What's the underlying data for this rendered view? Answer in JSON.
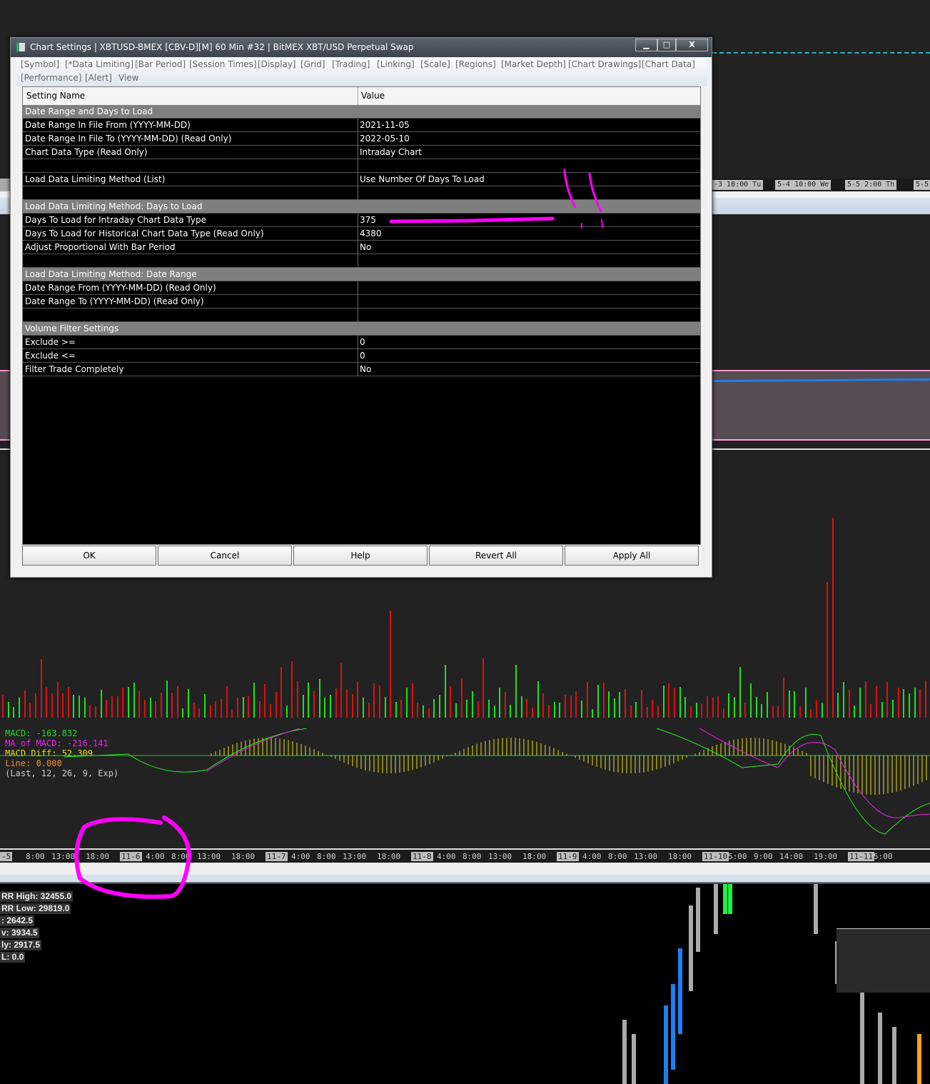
{
  "dialog": {
    "title": "Chart Settings | XBTUSD-BMEX [CBV-D][M]  60 Min   #32 | BitMEX XBT/USD Perpetual Swap",
    "minimize": "▁",
    "maximize": "□",
    "close": "X",
    "tabs": [
      "[Symbol]",
      "[*Data Limiting]",
      "[Bar Period]",
      "[Session Times]",
      "[Display]",
      "[Grid]",
      "[Trading]",
      "[Linking]",
      "[Scale]",
      "[Regions]",
      "[Market Depth]",
      "[Chart Drawings]",
      "[Chart Data]",
      "[Performance]",
      "[Alert]",
      "View"
    ],
    "columns": {
      "name": "Setting Name",
      "value": "Value"
    },
    "rows": [
      {
        "type": "sec",
        "name": "Date Range and Days to Load",
        "value": ""
      },
      {
        "type": "row",
        "name": "Date Range In File From (YYYY-MM-DD)",
        "value": "2021-11-05"
      },
      {
        "type": "row",
        "name": "Date Range In File To (YYYY-MM-DD) (Read Only)",
        "value": "2022-05-10"
      },
      {
        "type": "row",
        "name": "Chart Data Type (Read Only)",
        "value": "Intraday Chart"
      },
      {
        "type": "blank",
        "name": "",
        "value": ""
      },
      {
        "type": "row",
        "name": "Load Data Limiting Method (List)",
        "value": "Use Number Of Days To Load"
      },
      {
        "type": "blank",
        "name": "",
        "value": ""
      },
      {
        "type": "sec",
        "name": "Load Data Limiting Method: Days to Load",
        "value": ""
      },
      {
        "type": "row",
        "name": "Days To Load for Intraday Chart Data Type",
        "value": "375"
      },
      {
        "type": "row",
        "name": "Days To Load for Historical Chart Data Type (Read Only)",
        "value": "4380"
      },
      {
        "type": "row",
        "name": "Adjust Proportional With Bar Period",
        "value": "No"
      },
      {
        "type": "blank",
        "name": "",
        "value": ""
      },
      {
        "type": "sec",
        "name": "Load Data Limiting Method: Date Range",
        "value": ""
      },
      {
        "type": "row",
        "name": "Date Range From (YYYY-MM-DD) (Read Only)",
        "value": ""
      },
      {
        "type": "row",
        "name": "Date Range To (YYYY-MM-DD) (Read Only)",
        "value": ""
      },
      {
        "type": "blank",
        "name": "",
        "value": ""
      },
      {
        "type": "sec",
        "name": "Volume Filter Settings",
        "value": ""
      },
      {
        "type": "row",
        "name": "Exclude >=",
        "value": "0"
      },
      {
        "type": "row",
        "name": "Exclude <=",
        "value": "0"
      },
      {
        "type": "row",
        "name": "Filter Trade Completely",
        "value": "No"
      }
    ],
    "buttons": [
      "OK",
      "Cancel",
      "Help",
      "Revert All",
      "Apply All"
    ]
  },
  "top_axis": [
    "-3  18:00 Tu",
    "5-4  10:00 We",
    "5-5  2:00 Th",
    "5-5"
  ],
  "macd": {
    "macd": "MACD: -163.832",
    "ma": "MA of MACD: -216.141",
    "diff": "MACD Diff: 52.309",
    "line": "Line: 0.000",
    "params": "(Last, 12, 26, 9, Exp)"
  },
  "time_axis": [
    "-5",
    "8:00",
    "13:00",
    "18:00",
    "11-6",
    "4:00",
    "8:00",
    "13:00",
    "18:00",
    "11-7",
    "4:00",
    "8:00",
    "13:00",
    "18:00",
    "11-8",
    "4:00",
    "8:00",
    "13:00",
    "18:00",
    "11-9",
    "4:00",
    "8:00",
    "13:00",
    "18:00",
    "11-10",
    "5:00",
    "9:00",
    "14:00",
    "19:00",
    "11-11",
    "5:00"
  ],
  "info": [
    "RR High: 32455.0",
    "RR Low: 29819.0",
    ": 2642.5",
    "v: 3934.5",
    "ly: 2917.5",
    "L: 0.0"
  ],
  "colors": {
    "annotation": "#ff00ff",
    "up": "#22dd22",
    "down": "#dd1111"
  }
}
